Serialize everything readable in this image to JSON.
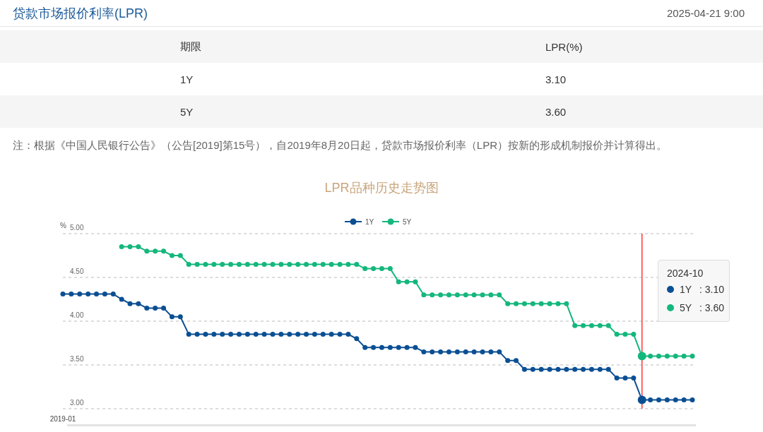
{
  "header": {
    "title": "贷款市场报价利率(LPR)",
    "timestamp": "2025-04-21 9:00"
  },
  "table": {
    "columns": [
      "期限",
      "LPR(%)"
    ],
    "rows": [
      [
        "1Y",
        "3.10"
      ],
      [
        "5Y",
        "3.60"
      ]
    ]
  },
  "note": "注：根据《中国人民银行公告》（公告[2019]第15号），自2019年8月20日起，贷款市场报价利率（LPR）按新的形成机制报价并计算得出。",
  "chart": {
    "chart_data": {
      "type": "line",
      "title": "LPR品种历史走势图",
      "ylabel": "%",
      "grid": true,
      "legend": true,
      "series": [
        {
          "name": "1Y",
          "color": "#0b4f93",
          "marker": "circle",
          "values": [
            4.31,
            4.31,
            4.31,
            4.31,
            4.31,
            4.31,
            4.31,
            4.25,
            4.2,
            4.2,
            4.15,
            4.15,
            4.15,
            4.05,
            4.05,
            3.85,
            3.85,
            3.85,
            3.85,
            3.85,
            3.85,
            3.85,
            3.85,
            3.85,
            3.85,
            3.85,
            3.85,
            3.85,
            3.85,
            3.85,
            3.85,
            3.85,
            3.85,
            3.85,
            3.85,
            3.8,
            3.7,
            3.7,
            3.7,
            3.7,
            3.7,
            3.7,
            3.7,
            3.65,
            3.65,
            3.65,
            3.65,
            3.65,
            3.65,
            3.65,
            3.65,
            3.65,
            3.65,
            3.55,
            3.55,
            3.45,
            3.45,
            3.45,
            3.45,
            3.45,
            3.45,
            3.45,
            3.45,
            3.45,
            3.45,
            3.45,
            3.35,
            3.35,
            3.35,
            3.1,
            3.1,
            3.1,
            3.1,
            3.1,
            3.1,
            3.1
          ]
        },
        {
          "name": "5Y",
          "color": "#14b77c",
          "marker": "circle",
          "values": [
            null,
            null,
            null,
            null,
            null,
            null,
            null,
            4.85,
            4.85,
            4.85,
            4.8,
            4.8,
            4.8,
            4.75,
            4.75,
            4.65,
            4.65,
            4.65,
            4.65,
            4.65,
            4.65,
            4.65,
            4.65,
            4.65,
            4.65,
            4.65,
            4.65,
            4.65,
            4.65,
            4.65,
            4.65,
            4.65,
            4.65,
            4.65,
            4.65,
            4.65,
            4.6,
            4.6,
            4.6,
            4.6,
            4.45,
            4.45,
            4.45,
            4.3,
            4.3,
            4.3,
            4.3,
            4.3,
            4.3,
            4.3,
            4.3,
            4.3,
            4.3,
            4.2,
            4.2,
            4.2,
            4.2,
            4.2,
            4.2,
            4.2,
            4.2,
            3.95,
            3.95,
            3.95,
            3.95,
            3.95,
            3.85,
            3.85,
            3.85,
            3.6,
            3.6,
            3.6,
            3.6,
            3.6,
            3.6,
            3.6
          ]
        }
      ],
      "yticks": [
        {
          "value": 3,
          "label": "3.00"
        },
        {
          "value": 3.5,
          "label": "3.50"
        },
        {
          "value": 4,
          "label": "4.00"
        },
        {
          "value": 4.5,
          "label": "4.50"
        },
        {
          "value": 5,
          "label": "5.00"
        }
      ],
      "ylim": [
        3,
        5
      ]
    },
    "x_axis_label": "2019-01",
    "tooltip": {
      "title": "2024-10",
      "items": [
        {
          "name": "1Y",
          "value": ": 3.10",
          "color": "#0b4f93"
        },
        {
          "name": "5Y",
          "value": ": 3.60",
          "color": "#14b77c"
        }
      ]
    }
  }
}
